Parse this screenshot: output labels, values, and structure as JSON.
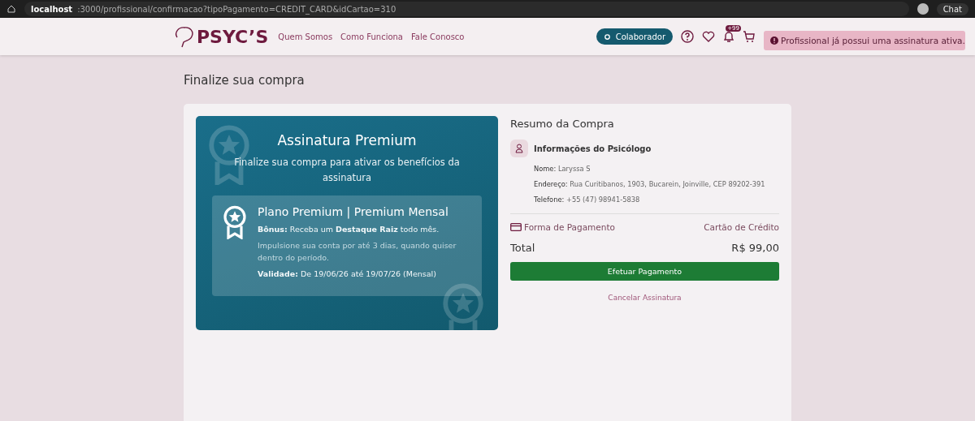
{
  "browser": {
    "url_host": "localhost",
    "url_rest": ":3000/profissional/confirmacao?tipoPagamento=CREDIT_CARD&idCartao=310",
    "chat": "Chat"
  },
  "nav": {
    "logo": "PSYC’S",
    "links": [
      "Quem Somos",
      "Como Funciona",
      "Fale Conosco"
    ],
    "collab_button": "Colaborador",
    "notification_badge": "+99"
  },
  "toast": {
    "message": "Profissional já possui uma assinatura ativa."
  },
  "page_title": "Finalize sua compra",
  "plan_card": {
    "title": "Assinatura Premium",
    "subtitle": "Finalize sua compra para ativar os benefícios da assinatura",
    "plan_name": "Plano Premium | Premium Mensal",
    "bonus": "**Bônus:** Receba um **Destaque Raiz** todo mês.",
    "boost": "Impulsione sua conta por até 3 dias, quando quiser dentro do período.",
    "validity": "**Validade:** De 19/06/26 até 19/07/26 (Mensal)"
  },
  "summary": {
    "title": "Resumo da Compra",
    "info_title": "Informações do Psicólogo",
    "info_lines": [
      "**Nome:** Laryssa S",
      "**Endereço:** Rua Curitibanos, 1903, Bucarein, Joinville, CEP 89202-391",
      "**Telefone:** +55 (47) 98941-5838"
    ],
    "payment_label": "Forma de Pagamento",
    "payment_value": "Cartão de Crédito",
    "total_label": "Total",
    "total_value": "R$ 99,00",
    "pay_button": "Efetuar Pagamento",
    "cancel_link": "Cancelar Assinatura"
  }
}
